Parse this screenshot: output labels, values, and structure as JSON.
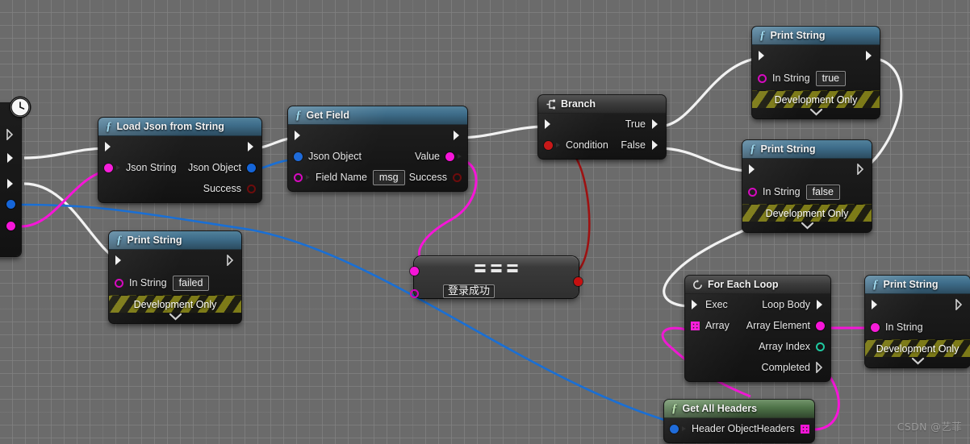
{
  "app": {
    "editor": "Unreal Engine Blueprint Graph",
    "watermark": "CSDN @艺菲"
  },
  "nodes": {
    "load_json": {
      "title": "Load Json from String",
      "icon": "function-icon",
      "header_kind": "function",
      "inputs": [
        {
          "name": "exec-in",
          "label": "",
          "pin": "exec"
        },
        {
          "name": "json-string",
          "label": "Json String",
          "pin": "magenta-dot"
        }
      ],
      "outputs": [
        {
          "name": "exec-out",
          "label": "",
          "pin": "exec"
        },
        {
          "name": "json-object",
          "label": "Json Object",
          "pin": "blue-dot"
        },
        {
          "name": "success",
          "label": "Success",
          "pin": "dark-red-ring"
        }
      ]
    },
    "get_field": {
      "title": "Get Field",
      "icon": "function-icon",
      "header_kind": "function",
      "inputs": [
        {
          "name": "exec-in",
          "label": "",
          "pin": "exec"
        },
        {
          "name": "json-object",
          "label": "Json Object",
          "pin": "blue-dot"
        },
        {
          "name": "field-name",
          "label": "Field Name",
          "pin": "magenta-ring",
          "value": "msg"
        }
      ],
      "outputs": [
        {
          "name": "exec-out",
          "label": "",
          "pin": "exec"
        },
        {
          "name": "value",
          "label": "Value",
          "pin": "magenta-dot"
        },
        {
          "name": "success",
          "label": "Success",
          "pin": "dark-red-ring"
        }
      ]
    },
    "branch": {
      "title": "Branch",
      "icon": "branch-icon",
      "header_kind": "grey",
      "inputs": [
        {
          "name": "exec-in",
          "label": "",
          "pin": "exec"
        },
        {
          "name": "condition",
          "label": "Condition",
          "pin": "red-dot"
        }
      ],
      "outputs": [
        {
          "name": "true",
          "label": "True",
          "pin": "exec"
        },
        {
          "name": "false",
          "label": "False",
          "pin": "exec"
        }
      ]
    },
    "equal_compact": {
      "title": "==",
      "icon": "equals-icon",
      "compare_value": "登录成功",
      "inputs": [
        {
          "name": "a",
          "pin": "magenta-dot"
        },
        {
          "name": "b",
          "pin": "magenta-ring",
          "value": "登录成功"
        }
      ],
      "outputs": [
        {
          "name": "result",
          "pin": "red-dot"
        }
      ]
    },
    "print_true": {
      "title": "Print String",
      "icon": "function-icon",
      "header_kind": "function",
      "in_string_label": "In String",
      "in_string_value": "true",
      "footer": "Development Only"
    },
    "print_false": {
      "title": "Print String",
      "icon": "function-icon",
      "header_kind": "function",
      "in_string_label": "In String",
      "in_string_value": "false",
      "footer": "Development Only"
    },
    "print_failed": {
      "title": "Print String",
      "icon": "function-icon",
      "header_kind": "function",
      "in_string_label": "In String",
      "in_string_value": "failed",
      "footer": "Development Only"
    },
    "print_header": {
      "title": "Print String",
      "icon": "function-icon",
      "header_kind": "function",
      "in_string_label": "In String",
      "in_string_value": "",
      "footer": "Development Only"
    },
    "for_each_loop": {
      "title": "For Each Loop",
      "icon": "loop-icon",
      "header_kind": "grey",
      "inputs": [
        {
          "name": "exec",
          "label": "Exec",
          "pin": "exec"
        },
        {
          "name": "array",
          "label": "Array",
          "pin": "magenta-grid"
        }
      ],
      "outputs": [
        {
          "name": "loop-body",
          "label": "Loop Body",
          "pin": "exec"
        },
        {
          "name": "array-element",
          "label": "Array Element",
          "pin": "magenta-dot"
        },
        {
          "name": "array-index",
          "label": "Array Index",
          "pin": "teal-ring"
        },
        {
          "name": "completed",
          "label": "Completed",
          "pin": "exec"
        }
      ]
    },
    "get_all_headers": {
      "title": "Get All Headers",
      "icon": "function-icon",
      "header_kind": "green",
      "inputs": [
        {
          "name": "header-object",
          "label": "Header Object",
          "pin": "blue-dot"
        }
      ],
      "outputs": [
        {
          "name": "headers",
          "label": "Headers",
          "pin": "magenta-grid"
        }
      ]
    }
  },
  "colors": {
    "exec_wire": "#f2f2f2",
    "string_wire": "#f615d8",
    "object_wire": "#1a6fd4",
    "bool_wire": "#9e1111",
    "function_header": "#3e6d8a",
    "grey_header": "#3b3b3b",
    "green_header": "#4e7348",
    "dev_only_stripe": "#7d7b18",
    "canvas": "#6b6b6b"
  }
}
